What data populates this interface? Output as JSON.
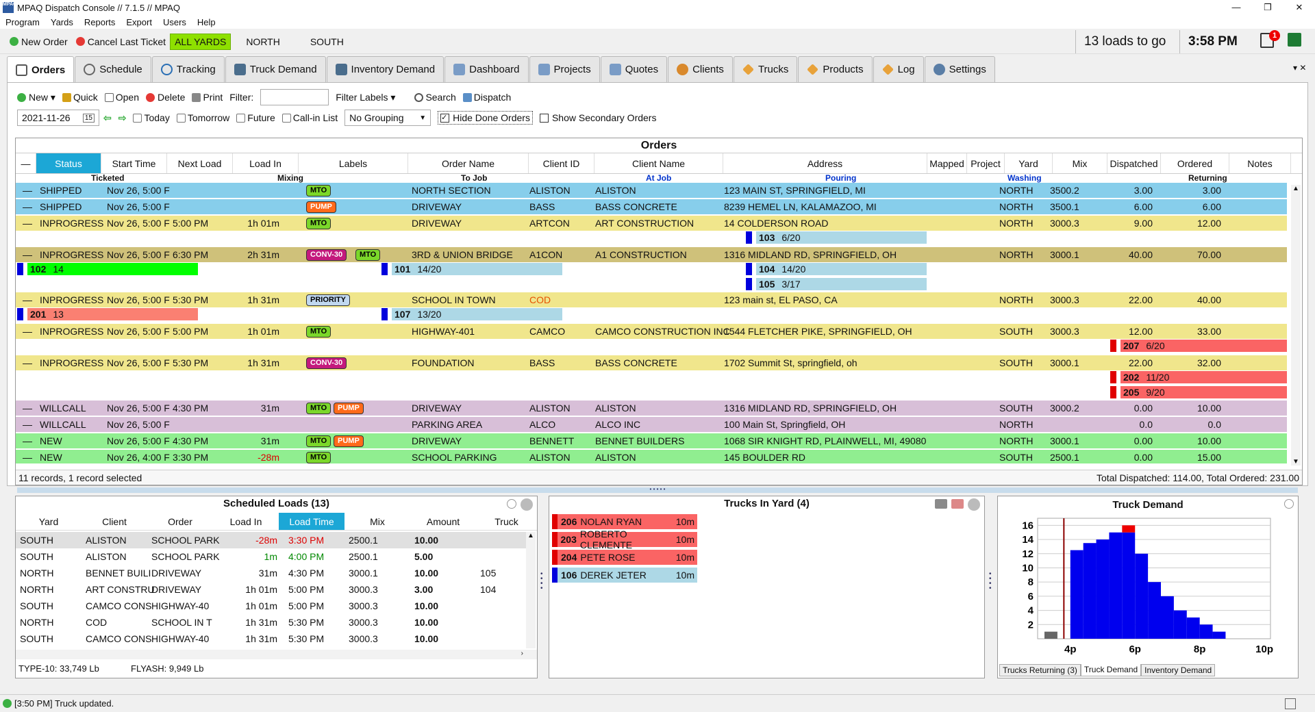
{
  "window": {
    "title": "MPAQ Dispatch Console // 7.1.5 // MPAQ",
    "minimize": "—",
    "restore": "❐",
    "close": "✕"
  },
  "menu": [
    "Program",
    "Yards",
    "Reports",
    "Export",
    "Users",
    "Help"
  ],
  "quickbar": {
    "new_order": "New Order",
    "cancel_last": "Cancel Last Ticket",
    "all_yards": "ALL YARDS",
    "north": "NORTH",
    "south": "SOUTH",
    "loads_to_go": "13 loads to go",
    "time": "3:58 PM",
    "badge": "1"
  },
  "tabs": [
    "Orders",
    "Schedule",
    "Tracking",
    "Truck Demand",
    "Inventory Demand",
    "Dashboard",
    "Projects",
    "Quotes",
    "Clients",
    "Trucks",
    "Products",
    "Log",
    "Settings"
  ],
  "toolbar": {
    "new": "New",
    "quick": "Quick",
    "open": "Open",
    "delete": "Delete",
    "print": "Print",
    "filter_label": "Filter:",
    "filter_labels": "Filter Labels",
    "search": "Search",
    "dispatch": "Dispatch",
    "date": "2021-11-26",
    "today": "Today",
    "tomorrow": "Tomorrow",
    "future": "Future",
    "call_in": "Call-in List",
    "grouping": "No Grouping",
    "hide_done": "Hide Done Orders",
    "show_secondary": "Show Secondary Orders"
  },
  "orders": {
    "title": "Orders",
    "columns": [
      "Status",
      "Start Time",
      "Next Load",
      "Load In",
      "Labels",
      "Order Name",
      "Client ID",
      "Client Name",
      "Address",
      "Mapped",
      "Project",
      "Yard",
      "Mix",
      "Dispatched",
      "Ordered",
      "Notes"
    ],
    "sub": {
      "ticketed": "Ticketed",
      "mixing": "Mixing",
      "to_job": "To Job",
      "at_job": "At Job",
      "pouring": "Pouring",
      "washing": "Washing",
      "returning": "Returning"
    },
    "rows": [
      {
        "status": "SHIPPED",
        "start": "Nov 26, 5:00 F",
        "next": "",
        "loadin": "",
        "labels": [
          "MTO"
        ],
        "order": "NORTH SECTION",
        "cid": "ALISTON",
        "cname": "ALISTON",
        "addr": "123 MAIN ST, SPRINGFIELD, MI",
        "yard": "NORTH",
        "mix": "3500.2",
        "disp": "3.00",
        "ord": "3.00"
      },
      {
        "status": "SHIPPED",
        "start": "Nov 26, 5:00 F",
        "next": "",
        "loadin": "",
        "labels": [
          "PUMP"
        ],
        "order": "DRIVEWAY",
        "cid": "BASS",
        "cname": "BASS CONCRETE",
        "addr": "8239 HEMEL LN, KALAMAZOO, MI",
        "yard": "NORTH",
        "mix": "3500.1",
        "disp": "6.00",
        "ord": "6.00"
      },
      {
        "status": "INPROGRESS",
        "start": "Nov 26, 5:00 F",
        "next": "5:00 PM",
        "loadin": "1h 01m",
        "labels": [
          "MTO"
        ],
        "order": "DRIVEWAY",
        "cid": "ARTCON",
        "cname": "ART CONSTRUCTION",
        "addr": "14 COLDERSON ROAD",
        "yard": "NORTH",
        "mix": "3000.3",
        "disp": "9.00",
        "ord": "12.00"
      },
      {
        "status": "INPROGRESS",
        "start": "Nov 26, 5:00 F",
        "next": "6:30 PM",
        "loadin": "2h 31m",
        "labels": [
          "CONV-30",
          "MTO"
        ],
        "order": "3RD & UNION BRIDGE",
        "cid": "A1CON",
        "cname": "A1 CONSTRUCTION",
        "addr": "1316 MIDLAND RD, SPRINGFIELD, OH",
        "yard": "NORTH",
        "mix": "3000.1",
        "disp": "40.00",
        "ord": "70.00"
      },
      {
        "status": "INPROGRESS",
        "start": "Nov 26, 5:00 F",
        "next": "5:30 PM",
        "loadin": "1h 31m",
        "labels": [
          "PRIORITY"
        ],
        "order": "SCHOOL IN TOWN",
        "cid": "COD",
        "cname": "",
        "addr": "123 main st, EL PASO, CA",
        "yard": "NORTH",
        "mix": "3000.3",
        "disp": "22.00",
        "ord": "40.00"
      },
      {
        "status": "INPROGRESS",
        "start": "Nov 26, 5:00 F",
        "next": "5:00 PM",
        "loadin": "1h 01m",
        "labels": [
          "MTO"
        ],
        "order": "HIGHWAY-401",
        "cid": "CAMCO",
        "cname": "CAMCO CONSTRUCTION INC",
        "addr": "1544 FLETCHER PIKE, SPRINGFIELD, OH",
        "yard": "SOUTH",
        "mix": "3000.3",
        "disp": "12.00",
        "ord": "33.00"
      },
      {
        "status": "INPROGRESS",
        "start": "Nov 26, 5:00 F",
        "next": "5:30 PM",
        "loadin": "1h 31m",
        "labels": [
          "CONV-30"
        ],
        "order": "FOUNDATION",
        "cid": "BASS",
        "cname": "BASS CONCRETE",
        "addr": "1702 Summit St, springfield, oh",
        "yard": "SOUTH",
        "mix": "3000.1",
        "disp": "22.00",
        "ord": "32.00"
      },
      {
        "status": "WILLCALL",
        "start": "Nov 26, 5:00 F",
        "next": "4:30 PM",
        "loadin": "31m",
        "labels": [
          "MTO",
          "PUMP"
        ],
        "order": "DRIVEWAY",
        "cid": "ALISTON",
        "cname": "ALISTON",
        "addr": "1316 MIDLAND RD, SPRINGFIELD, OH",
        "yard": "SOUTH",
        "mix": "3000.2",
        "disp": "0.00",
        "ord": "10.00"
      },
      {
        "status": "WILLCALL",
        "start": "Nov 26, 5:00 F",
        "next": "",
        "loadin": "",
        "labels": [],
        "order": "PARKING AREA",
        "cid": "ALCO",
        "cname": "ALCO INC",
        "addr": "100 Main St, Springfield, OH",
        "yard": "NORTH",
        "mix": "",
        "disp": "0.0",
        "ord": "0.0"
      },
      {
        "status": "NEW",
        "start": "Nov 26, 5:00 F",
        "next": "4:30 PM",
        "loadin": "31m",
        "labels": [
          "MTO",
          "PUMP"
        ],
        "order": "DRIVEWAY",
        "cid": "BENNETT",
        "cname": "BENNET BUILDERS",
        "addr": "1068 SIR KNIGHT RD, PLAINWELL, MI, 49080",
        "yard": "NORTH",
        "mix": "3000.1",
        "disp": "0.00",
        "ord": "10.00"
      },
      {
        "status": "NEW",
        "start": "Nov 26, 4:00 F",
        "next": "3:30 PM",
        "loadin": "-28m",
        "labels": [
          "MTO"
        ],
        "order": "SCHOOL PARKING",
        "cid": "ALISTON",
        "cname": "ALISTON",
        "addr": "145 BOULDER RD",
        "yard": "SOUTH",
        "mix": "2500.1",
        "disp": "0.00",
        "ord": "15.00"
      }
    ],
    "loads": [
      {
        "num": "103",
        "val": "6/20"
      },
      {
        "num": "102",
        "val": "14"
      },
      {
        "num": "101",
        "val": "14/20"
      },
      {
        "num": "104",
        "val": "14/20"
      },
      {
        "num": "105",
        "val": "3/17"
      },
      {
        "num": "201",
        "val": "13"
      },
      {
        "num": "107",
        "val": "13/20"
      },
      {
        "num": "207",
        "val": "6/20"
      },
      {
        "num": "202",
        "val": "11/20"
      },
      {
        "num": "205",
        "val": "9/20"
      }
    ],
    "records": "11 records, 1 record selected",
    "totals": "Total Dispatched: 114.00, Total Ordered: 231.00"
  },
  "scheduled": {
    "title": "Scheduled Loads (13)",
    "columns": [
      "Yard",
      "Client",
      "Order",
      "Load In",
      "Load Time",
      "Mix",
      "Amount",
      "Truck"
    ],
    "rows": [
      {
        "yard": "SOUTH",
        "client": "ALISTON",
        "order": "SCHOOL PARK",
        "loadin": "-28m",
        "time": "3:30 PM",
        "mix": "2500.1",
        "amount": "10.00",
        "truck": ""
      },
      {
        "yard": "SOUTH",
        "client": "ALISTON",
        "order": "SCHOOL PARK",
        "loadin": "1m",
        "time": "4:00 PM",
        "mix": "2500.1",
        "amount": "5.00",
        "truck": ""
      },
      {
        "yard": "NORTH",
        "client": "BENNET BUILI",
        "order": "DRIVEWAY",
        "loadin": "31m",
        "time": "4:30 PM",
        "mix": "3000.1",
        "amount": "10.00",
        "truck": "105"
      },
      {
        "yard": "NORTH",
        "client": "ART CONSTRU",
        "order": "DRIVEWAY",
        "loadin": "1h 01m",
        "time": "5:00 PM",
        "mix": "3000.3",
        "amount": "3.00",
        "truck": "104"
      },
      {
        "yard": "SOUTH",
        "client": "CAMCO CONS",
        "order": "HIGHWAY-40",
        "loadin": "1h 01m",
        "time": "5:00 PM",
        "mix": "3000.3",
        "amount": "10.00",
        "truck": ""
      },
      {
        "yard": "NORTH",
        "client": "COD",
        "order": "SCHOOL IN T",
        "loadin": "1h 31m",
        "time": "5:30 PM",
        "mix": "3000.3",
        "amount": "10.00",
        "truck": ""
      },
      {
        "yard": "SOUTH",
        "client": "CAMCO CONS",
        "order": "HIGHWAY-40",
        "loadin": "1h 31m",
        "time": "5:30 PM",
        "mix": "3000.3",
        "amount": "10.00",
        "truck": ""
      }
    ],
    "footer_type": "TYPE-10: 33,749 Lb",
    "footer_flyash": "FLYASH: 9,949 Lb"
  },
  "trucks_in_yard": {
    "title": "Trucks In Yard (4)",
    "trucks": [
      {
        "num": "206",
        "name": "NOLAN RYAN",
        "time": "10m"
      },
      {
        "num": "203",
        "name": "ROBERTO CLEMENTE",
        "time": "10m"
      },
      {
        "num": "204",
        "name": "PETE ROSE",
        "time": "10m"
      },
      {
        "num": "106",
        "name": "DEREK JETER",
        "time": "10m"
      }
    ]
  },
  "truck_demand": {
    "title": "Truck Demand",
    "tabs": [
      "Trucks Returning (3)",
      "Truck Demand",
      "Inventory Demand"
    ]
  },
  "chart_data": {
    "type": "bar",
    "title": "Truck Demand",
    "xlabel": "",
    "ylabel": "",
    "x_ticks": [
      "4p",
      "6p",
      "8p",
      "10p"
    ],
    "y_ticks": [
      2,
      4,
      6,
      8,
      10,
      12,
      14,
      16
    ],
    "ylim": [
      0,
      17
    ],
    "series": [
      {
        "values": [
          1,
          0,
          12.5,
          13.5,
          14,
          15,
          15,
          12,
          8,
          6,
          4,
          3,
          2,
          1
        ]
      },
      {
        "values": [
          0,
          0,
          0,
          0,
          0,
          0,
          1,
          0,
          0,
          0,
          0,
          0,
          0,
          0
        ]
      }
    ]
  },
  "statusbar": {
    "message": "[3:50 PM] Truck updated."
  },
  "colors": {
    "shipped": "#87ceeb",
    "inprogress": "#f0e68c",
    "inprogress_dark": "#cfc17a",
    "willcall": "#d8bfd8",
    "new": "#90ee90",
    "accent": "#1ca7d6"
  }
}
